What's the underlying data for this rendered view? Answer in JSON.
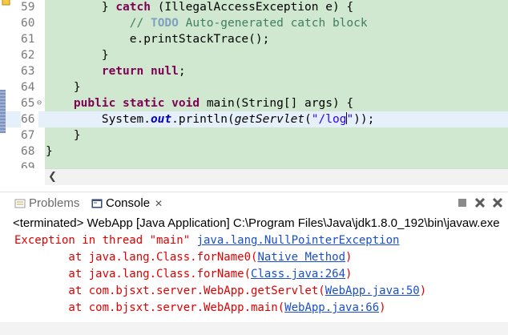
{
  "editor": {
    "lines": [
      {
        "num": "59",
        "parts": [
          {
            "t": "        } ",
            "c": ""
          },
          {
            "t": "catch",
            "c": "kw"
          },
          {
            "t": " (IllegalAccessException e) {",
            "c": ""
          }
        ]
      },
      {
        "num": "60",
        "parts": [
          {
            "t": "            ",
            "c": ""
          },
          {
            "t": "// ",
            "c": "cm"
          },
          {
            "t": "TODO",
            "c": "todo"
          },
          {
            "t": " Auto-generated catch block",
            "c": "cm"
          }
        ]
      },
      {
        "num": "61",
        "parts": [
          {
            "t": "            e.printStackTrace();",
            "c": ""
          }
        ]
      },
      {
        "num": "62",
        "parts": [
          {
            "t": "        }",
            "c": ""
          }
        ]
      },
      {
        "num": "63",
        "parts": [
          {
            "t": "        ",
            "c": ""
          },
          {
            "t": "return",
            "c": "kw"
          },
          {
            "t": " ",
            "c": ""
          },
          {
            "t": "null",
            "c": "kw"
          },
          {
            "t": ";",
            "c": ""
          }
        ]
      },
      {
        "num": "64",
        "parts": [
          {
            "t": "    }",
            "c": ""
          }
        ]
      },
      {
        "num": "65",
        "parts": [
          {
            "t": "    ",
            "c": ""
          },
          {
            "t": "public",
            "c": "kw"
          },
          {
            "t": " ",
            "c": ""
          },
          {
            "t": "static",
            "c": "kw"
          },
          {
            "t": " ",
            "c": ""
          },
          {
            "t": "void",
            "c": "kw"
          },
          {
            "t": " main(String[] args) {",
            "c": ""
          }
        ]
      },
      {
        "num": "66",
        "parts": [
          {
            "t": "        System.",
            "c": ""
          },
          {
            "t": "out",
            "c": "fld"
          },
          {
            "t": ".println(",
            "c": ""
          },
          {
            "t": "getServlet",
            "c": "it"
          },
          {
            "t": "(",
            "c": ""
          },
          {
            "t": "\"/log",
            "c": "str"
          },
          {
            "t": "CARET",
            "c": "caret"
          },
          {
            "t": "\"",
            "c": "str"
          },
          {
            "t": "));",
            "c": ""
          }
        ]
      },
      {
        "num": "67",
        "parts": [
          {
            "t": "    }",
            "c": ""
          }
        ]
      },
      {
        "num": "68",
        "parts": [
          {
            "t": "}",
            "c": ""
          }
        ]
      },
      {
        "num": "69",
        "parts": []
      }
    ],
    "current_line": "66",
    "fold_line": "65",
    "fold_symbol": "⊖"
  },
  "tabs": {
    "problems": "Problems",
    "console": "Console",
    "close_symbol": "✕"
  },
  "console": {
    "header": "<terminated> WebApp [Java Application] C:\\Program Files\\Java\\jdk1.8.0_192\\bin\\javaw.exe",
    "lines": [
      {
        "pre": "Exception in thread \"main\" ",
        "link": "java.lang.NullPointerException",
        "post": ""
      },
      {
        "pre": "        at java.lang.Class.forName0(",
        "link": "Native Method",
        "post": ")"
      },
      {
        "pre": "        at java.lang.Class.forName(",
        "link": "Class.java:264",
        "post": ")"
      },
      {
        "pre": "        at com.bjsxt.server.WebApp.getServlet(",
        "link": "WebApp.java:50",
        "post": ")"
      },
      {
        "pre": "        at com.bjsxt.server.WebApp.main(",
        "link": "WebApp.java:66",
        "post": ")"
      }
    ]
  },
  "colors": {
    "editor_bg": "#cfe8cf",
    "error_text": "#e00000",
    "link": "#1a4fc8",
    "keyword": "#7f0055"
  }
}
